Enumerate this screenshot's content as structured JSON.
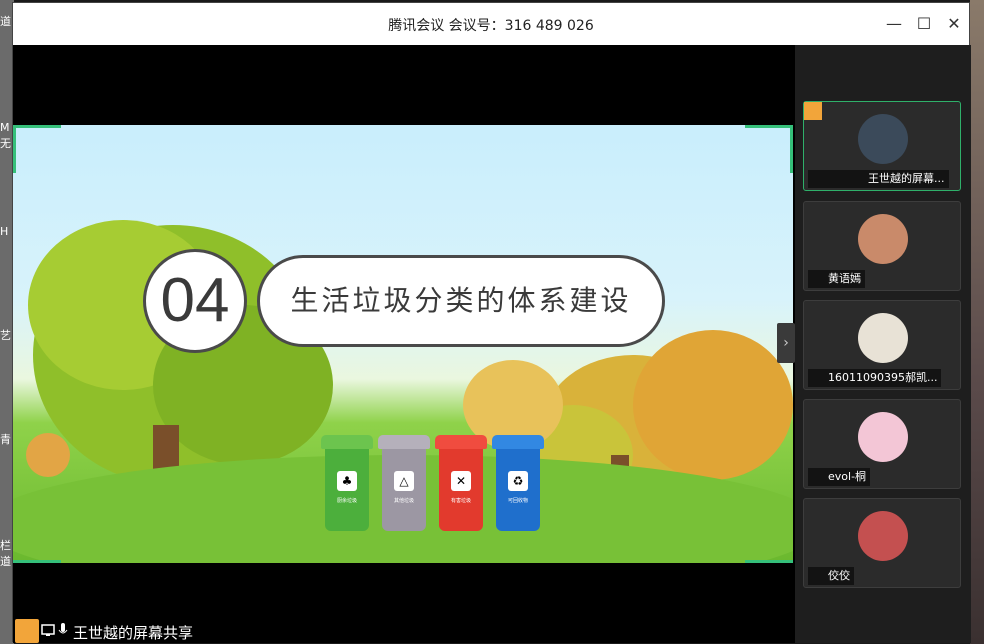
{
  "window": {
    "title": "腾讯会议 会议号：316 489 026",
    "minimize_label": "—",
    "maximize_label": "☐",
    "close_label": "✕"
  },
  "desktop_left": [
    "道",
    "M",
    "无",
    "H",
    "艺",
    "青",
    "栏",
    "道"
  ],
  "slide": {
    "section_number": "04",
    "section_title": "生活垃圾分类的体系建设",
    "next_arrow": "›",
    "bins": [
      {
        "label": "厨余垃圾",
        "color": "#4caf3c",
        "lid": "#6cc44e"
      },
      {
        "label": "其他垃圾",
        "color": "#9c97a3",
        "lid": "#b5b0bb"
      },
      {
        "label": "有害垃圾",
        "color": "#e23a2d",
        "lid": "#f04c3f"
      },
      {
        "label": "可回收物",
        "color": "#1f6fcc",
        "lid": "#3288e2"
      }
    ]
  },
  "share_status": "王世越的屏幕共享",
  "participants": [
    {
      "name": "王世越的屏幕...",
      "avatar_color": "#3b4a5a",
      "active": true
    },
    {
      "name": "黄语嫣",
      "avatar_color": "#c98a6a",
      "active": false
    },
    {
      "name": "16011090395郝凯...",
      "avatar_color": "#e8e2d6",
      "active": false
    },
    {
      "name": "evol-桐",
      "avatar_color": "#f3c6d6",
      "active": false
    },
    {
      "name": "佼佼",
      "avatar_color": "#c45050",
      "active": false
    }
  ]
}
